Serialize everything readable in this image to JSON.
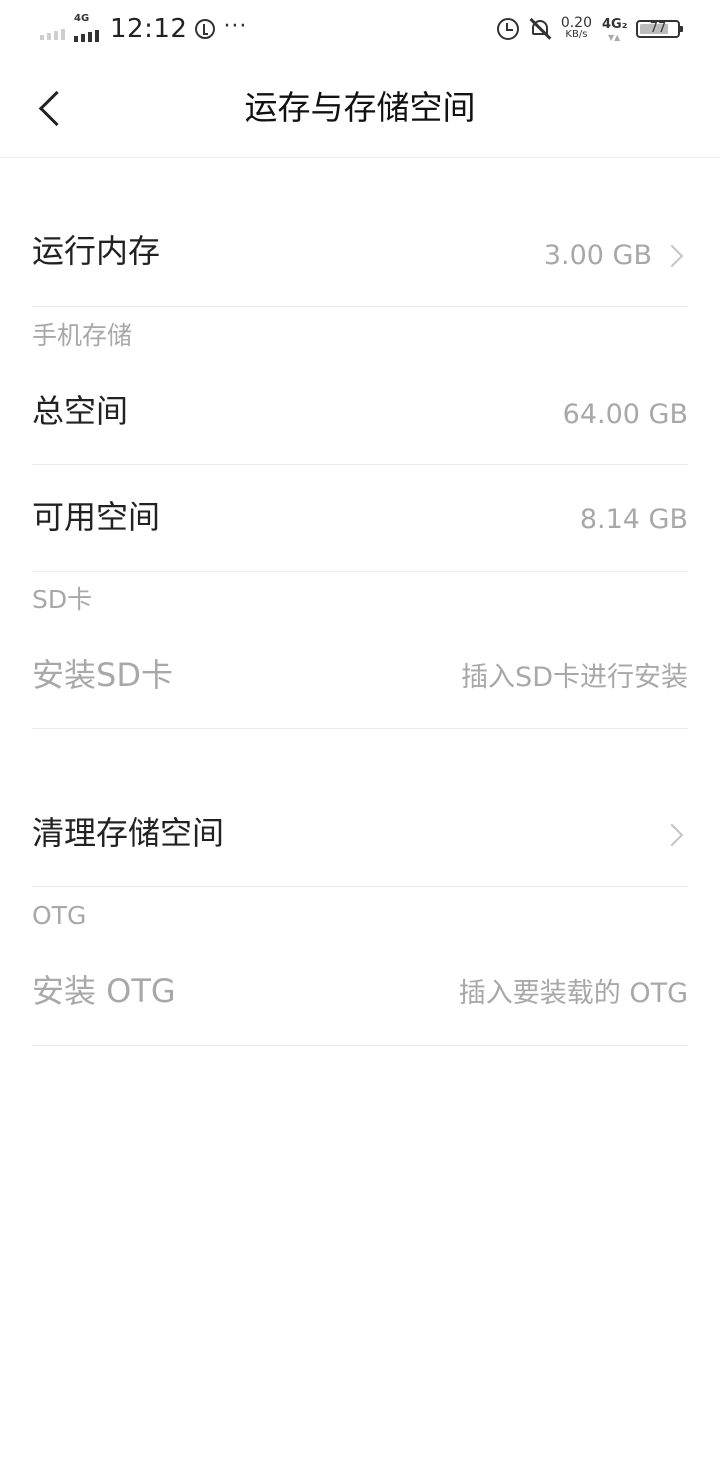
{
  "status_bar": {
    "time": "12:12",
    "network_tag": "4G",
    "more": "···",
    "net_speed_value": "0.20",
    "net_speed_unit": "KB/s",
    "sim2_tag": "4G₂",
    "battery_level": "77",
    "battery_fraction": 0.77
  },
  "nav": {
    "title": "运存与存储空间"
  },
  "ram": {
    "label": "运行内存",
    "value": "3.00 GB"
  },
  "phone_storage": {
    "header": "手机存储",
    "total_label": "总空间",
    "total_value": "64.00 GB",
    "available_label": "可用空间",
    "available_value": "8.14 GB"
  },
  "sd_card": {
    "header": "SD卡",
    "install_label": "安装SD卡",
    "install_hint": "插入SD卡进行安装"
  },
  "cleanup": {
    "label": "清理存储空间"
  },
  "otg": {
    "header": "OTG",
    "install_label": "安装 OTG",
    "install_hint": "插入要装载的 OTG"
  }
}
